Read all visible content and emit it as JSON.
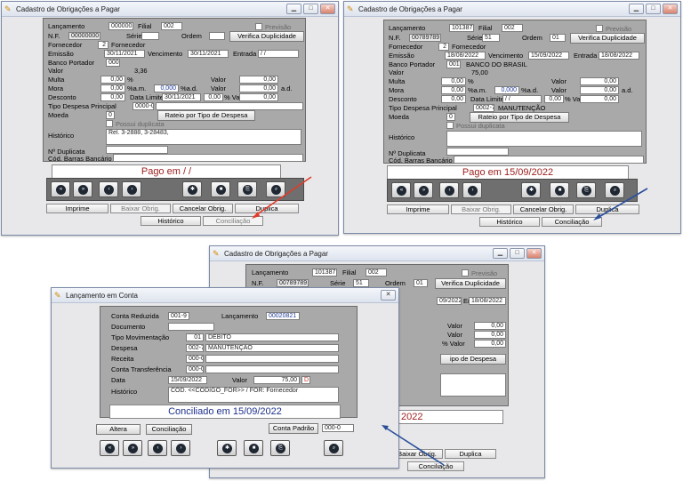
{
  "window_title": "Cadastro de Obrigações a Pagar",
  "labels": {
    "lancamento": "Lançamento",
    "filial": "Filial",
    "previsao": "Previsão",
    "nf": "N.F.",
    "serie": "Série",
    "ordem": "Ordem",
    "verifica": "Verifica Duplicidade",
    "fornecedor": "Fornecedor",
    "emissao": "Emissão",
    "vencimento": "Vencimento",
    "entrada": "Entrada",
    "banco": "Banco Portador",
    "valor": "Valor",
    "multa": "Multa",
    "mora": "Mora",
    "desconto": "Desconto",
    "data_limite": "Data Limite",
    "tipo_despesa": "Tipo Despesa Principal",
    "moeda": "Moeda",
    "possui_dup": "Possui duplicata",
    "rateio": "Rateio por Tipo de Despesa",
    "historico": "Histórico",
    "n_duplicata": "Nº Duplicata",
    "cod_barras": "Cód. Barras Bancário",
    "pct": "%",
    "pct_am": "%a.m.",
    "pct_ad": "%a.d.",
    "ad": "a.d.",
    "pct_valor": "% Valor"
  },
  "tabs": {
    "imprime": "Imprime",
    "baixar": "Baixar Obrig.",
    "cancelar": "Cancelar Obrig.",
    "duplica": "Duplica",
    "historico": "Histórico",
    "conciliacao": "Conciliação"
  },
  "win1": {
    "lancamento": "000000",
    "filial": "002",
    "nf": "00000000",
    "fornecedor_cod": "2",
    "fornecedor_nome": "Fornecedor",
    "emissao": "30/11/2021",
    "vencimento": "30/11/2021",
    "entrada": "/ /",
    "banco_cod": "000",
    "valor": "3,36",
    "multa": "0,00",
    "mora": "0,00",
    "mora_ad": "0,000",
    "mora_valor": "0,00",
    "desc": "0,00",
    "data_limite": "30/11/2021",
    "desc_pct": "0,00",
    "desc_valor": "0,00",
    "multa_valor": "0,00",
    "tipo_cod": "0000-0",
    "moeda": "0",
    "historico": "Rel. 3-2888, 3-28483,",
    "status": "Pago em  / /"
  },
  "win2": {
    "lancamento": "101387",
    "filial": "002",
    "nf": "00789789",
    "serie": "51",
    "ordem": "01",
    "fornecedor_cod": "2",
    "fornecedor_nome": "Fornecedor",
    "emissao": "18/08/2022",
    "vencimento": "15/09/2022",
    "entrada": "18/08/2022",
    "banco_cod": "001",
    "banco_nome": "BANCO DO BRASIL",
    "valor": "75,00",
    "multa": "0,00",
    "mora": "0,00",
    "mora_ad": "0,000",
    "mora_valor": "0,00",
    "desc": "0,00",
    "data_limite": "/ /",
    "desc_pct": "0,00",
    "desc_valor": "0,00",
    "multa_valor": "0,00",
    "tipo_cod": "0002-7",
    "tipo_nome": "MANUTENÇÃO",
    "moeda": "0",
    "status": "Pago em 15/09/2022"
  },
  "win3": {
    "lancamento": "101387",
    "filial": "002",
    "nf": "00789789",
    "serie": "51",
    "ordem": "01",
    "vencimento_partial": "09/2022",
    "entrada": "18/08/2022",
    "valor_a": "0,00",
    "valor_b": "0,00",
    "valor_c": "0,00",
    "ad": "a.d.",
    "status_partial": "2022",
    "rateio_partial": "ipo de Despesa",
    "pct_valor": "% Valor"
  },
  "dialog": {
    "title": "Lançamento em Conta",
    "labels": {
      "conta_reduzida": "Conta Reduzida",
      "lancamento": "Lançamento",
      "documento": "Documento",
      "tipo_mov": "Tipo Movimentação",
      "despesa": "Despesa",
      "receita": "Receita",
      "conta_transf": "Conta Transferência",
      "data": "Data",
      "valor": "Valor",
      "historico": "Histórico"
    },
    "conta_reduzida": "001-9",
    "lancamento": "00020821",
    "tipo_mov_cod": "01",
    "tipo_mov": "DEBITO",
    "despesa_cod": "002-7",
    "despesa": "MANUTENÇÃO",
    "receita": "000-0",
    "conta_transf": "000-0",
    "data": "15/09/2022",
    "valor": "75,00",
    "dc": "D",
    "historico": "COD. <<CODIGO_FOR>> / FOR: Fornecedor",
    "status": "Conciliado em 15/09/2022",
    "buttons": {
      "altera": "Altera",
      "conciliacao": "Conciliação",
      "conta_padrao": "Conta Padrão"
    },
    "conta_padrao_val": "000-0"
  },
  "colors": {
    "arrow_red": "#e23b2a",
    "arrow_blue": "#2a4f9a",
    "status_red": "#9b1c1c",
    "status_blue": "#1d2f8c"
  },
  "icons": [
    "app-icon",
    "minimize-icon",
    "maximize-icon",
    "close-icon",
    "first-icon",
    "last-icon",
    "prev-icon",
    "next-icon",
    "new-icon",
    "stop-icon",
    "save-icon",
    "search-icon"
  ]
}
